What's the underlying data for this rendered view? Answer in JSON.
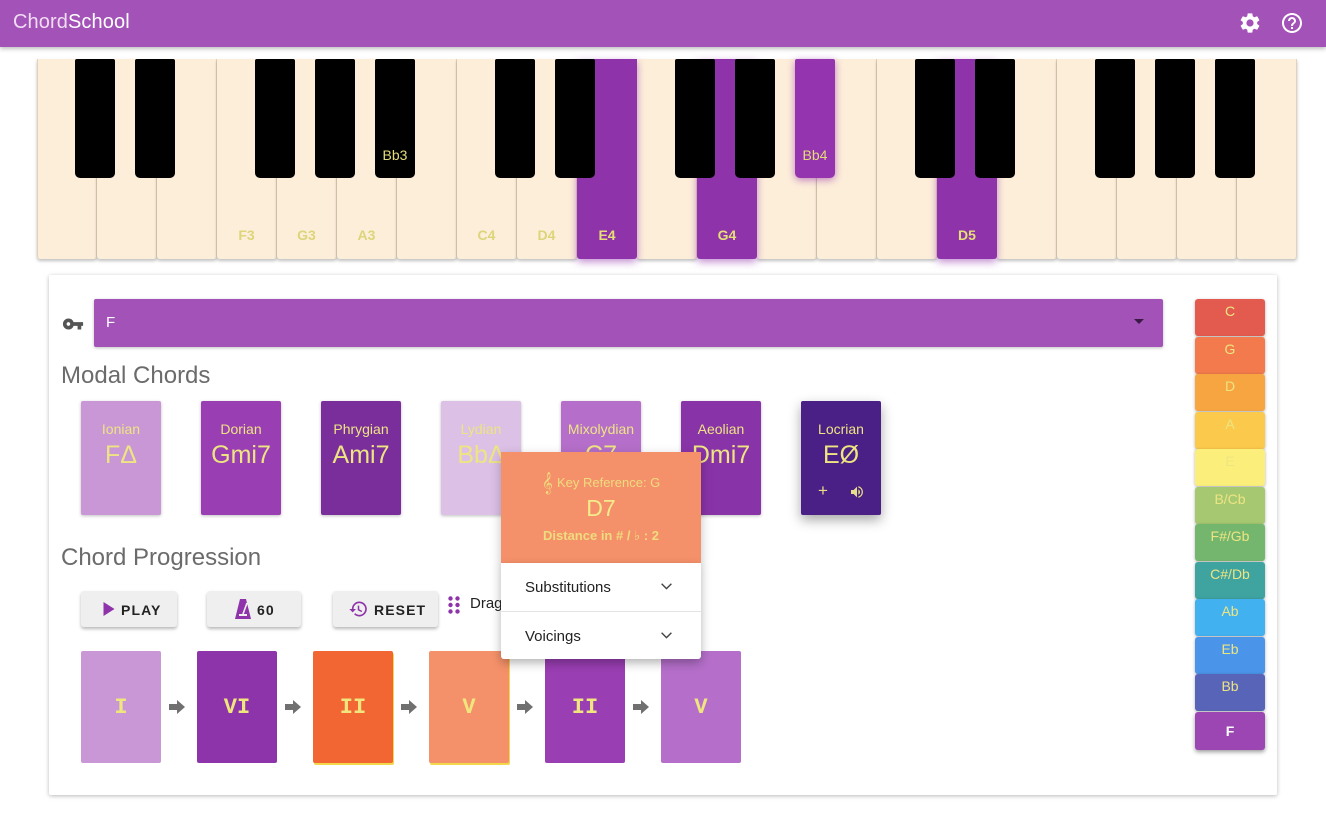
{
  "app": {
    "brand_part1": "Chord",
    "brand_part2": "School"
  },
  "header_icons": [
    "gear-icon",
    "help-circle-icon"
  ],
  "piano": {
    "white_keys": [
      {
        "label": "",
        "active": false
      },
      {
        "label": "",
        "active": false
      },
      {
        "label": "",
        "active": false
      },
      {
        "label": "F3",
        "active": false
      },
      {
        "label": "G3",
        "active": false
      },
      {
        "label": "A3",
        "active": false
      },
      {
        "label": "",
        "active": false
      },
      {
        "label": "C4",
        "active": false
      },
      {
        "label": "D4",
        "active": false
      },
      {
        "label": "E4",
        "active": true
      },
      {
        "label": "",
        "active": false
      },
      {
        "label": "G4",
        "active": true
      },
      {
        "label": "",
        "active": false
      },
      {
        "label": "",
        "active": false
      },
      {
        "label": "",
        "active": false
      },
      {
        "label": "D5",
        "active": true
      },
      {
        "label": "",
        "active": false
      },
      {
        "label": "",
        "active": false
      },
      {
        "label": "",
        "active": false
      },
      {
        "label": "",
        "active": false
      },
      {
        "label": "",
        "active": false
      }
    ],
    "black_keys": [
      {
        "label": "",
        "active": false
      },
      {
        "label": "",
        "active": false
      },
      {
        "label": "",
        "active": false
      },
      {
        "label": "",
        "active": false
      },
      {
        "label": "Bb3",
        "active": false
      },
      {
        "label": "",
        "active": false
      },
      {
        "label": "",
        "active": false
      },
      {
        "label": "",
        "active": false
      },
      {
        "label": "",
        "active": false
      },
      {
        "label": "Bb4",
        "active": true
      },
      {
        "label": "",
        "active": false
      },
      {
        "label": "",
        "active": false
      },
      {
        "label": "",
        "active": false
      },
      {
        "label": "",
        "active": false
      },
      {
        "label": "",
        "active": false
      }
    ]
  },
  "key_select": {
    "icon": "key-icon",
    "value": "F"
  },
  "modal": {
    "title": "Modal Chords",
    "cards": [
      {
        "mode": "Ionian",
        "chord": "FΔ",
        "color": "#c997d5"
      },
      {
        "mode": "Dorian",
        "chord": "Gmi7",
        "color": "#9a3eb3"
      },
      {
        "mode": "Phrygian",
        "chord": "Ami7",
        "color": "#7a2e9c"
      },
      {
        "mode": "Lydian",
        "chord": "BbΔ",
        "color": "#dcc0e6"
      },
      {
        "mode": "Mixolydian",
        "chord": "C7",
        "color": "#b56fca"
      },
      {
        "mode": "Aeolian",
        "chord": "Dmi7",
        "color": "#8933a8"
      },
      {
        "mode": "Locrian",
        "chord": "EØ",
        "color": "#4a1f86"
      }
    ],
    "locrian_actions": {
      "add": "+",
      "sound_icon": "volume-icon"
    }
  },
  "popover": {
    "clef": "𝄞",
    "reference": "Key Reference: G",
    "chord": "D7",
    "distance": "Distance in # / ♭ : 2",
    "panels": [
      "Substitutions",
      "Voicings"
    ]
  },
  "progression": {
    "title": "Chord Progression",
    "play_label": "PLAY",
    "tempo_label": "60",
    "reset_label": "RESET",
    "drag_label": "Drag",
    "cards": [
      {
        "numeral": "I",
        "color": "#c997d5",
        "highlight": false
      },
      {
        "numeral": "VI",
        "color": "#8e34aa",
        "highlight": false
      },
      {
        "numeral": "II",
        "color": "#f26633",
        "highlight": true
      },
      {
        "numeral": "V",
        "color": "#f5916a",
        "highlight": true
      },
      {
        "numeral": "II",
        "color": "#9a3eb3",
        "highlight": false
      },
      {
        "numeral": "V",
        "color": "#b56fca",
        "highlight": false
      }
    ]
  },
  "keys_sidebar": [
    {
      "label": "C",
      "color": "#e35a4e"
    },
    {
      "label": "G",
      "color": "#f27a4c"
    },
    {
      "label": "D",
      "color": "#f7a541"
    },
    {
      "label": "A",
      "color": "#fbc94b"
    },
    {
      "label": "E",
      "color": "#fbee7a"
    },
    {
      "label": "B/Cb",
      "color": "#a6c870"
    },
    {
      "label": "F#/Gb",
      "color": "#74b66d"
    },
    {
      "label": "C#/Db",
      "color": "#3fa3a0"
    },
    {
      "label": "Ab",
      "color": "#42b1ef"
    },
    {
      "label": "Eb",
      "color": "#4a94e9"
    },
    {
      "label": "Bb",
      "color": "#5864b8"
    },
    {
      "label": "F",
      "color": "#9b46b3",
      "selected": true
    }
  ]
}
